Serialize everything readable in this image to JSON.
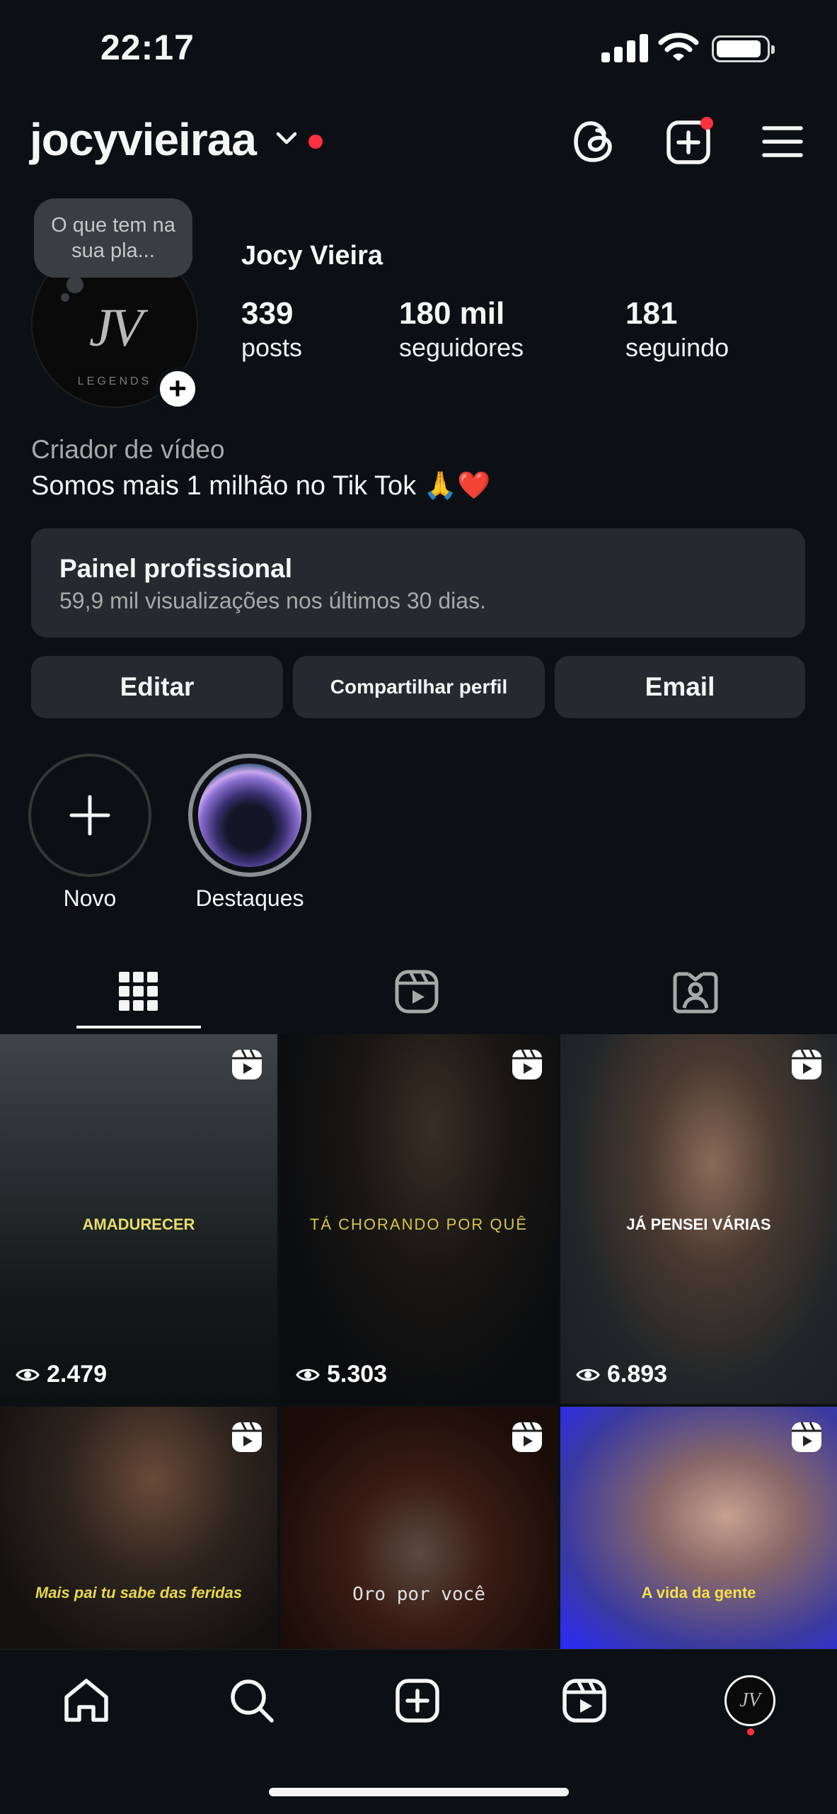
{
  "status_bar": {
    "time": "22:17"
  },
  "header": {
    "username": "jocyvieiraa"
  },
  "profile": {
    "note_text": "O que tem na sua pla...",
    "display_name": "Jocy Vieira",
    "stats": [
      {
        "value": "339",
        "label": "posts"
      },
      {
        "value": "180 mil",
        "label": "seguidores"
      },
      {
        "value": "181",
        "label": "seguindo"
      }
    ],
    "category": "Criador de vídeo",
    "bio": "Somos mais 1 milhão no Tik Tok 🙏❤️"
  },
  "professional_dashboard": {
    "title": "Painel profissional",
    "subtitle": "59,9 mil visualizações nos últimos 30 dias."
  },
  "actions": {
    "edit": "Editar",
    "share": "Compartilhar perfil",
    "email": "Email"
  },
  "highlights": [
    {
      "label": "Novo"
    },
    {
      "label": "Destaques"
    }
  ],
  "posts": [
    {
      "caption": "AMADURECER",
      "views": "2.479",
      "caption_color": "#e8dd6a"
    },
    {
      "caption": "TÁ CHORANDO POR QUÊ",
      "views": "5.303",
      "caption_color": "#d9c54a"
    },
    {
      "caption": "JÁ PENSEI VÁRIAS",
      "views": "6.893",
      "caption_color": "#ffffff"
    },
    {
      "caption": "Mais pai tu sabe das feridas",
      "views": "",
      "caption_color": "#e8d84a"
    },
    {
      "caption": "Oro por você",
      "views": "",
      "caption_color": "#e0e0e0"
    },
    {
      "caption": "A vida da gente",
      "views": "",
      "caption_color": "#f2e04a"
    }
  ],
  "colors": {
    "background": "#0c1014",
    "surface": "#262a30",
    "notification": "#ff3040"
  },
  "icons": [
    "threads-icon",
    "create-icon",
    "menu-icon",
    "grid-icon",
    "reels-icon",
    "tagged-icon",
    "home-icon",
    "search-icon",
    "reel-icon",
    "eye-icon"
  ]
}
